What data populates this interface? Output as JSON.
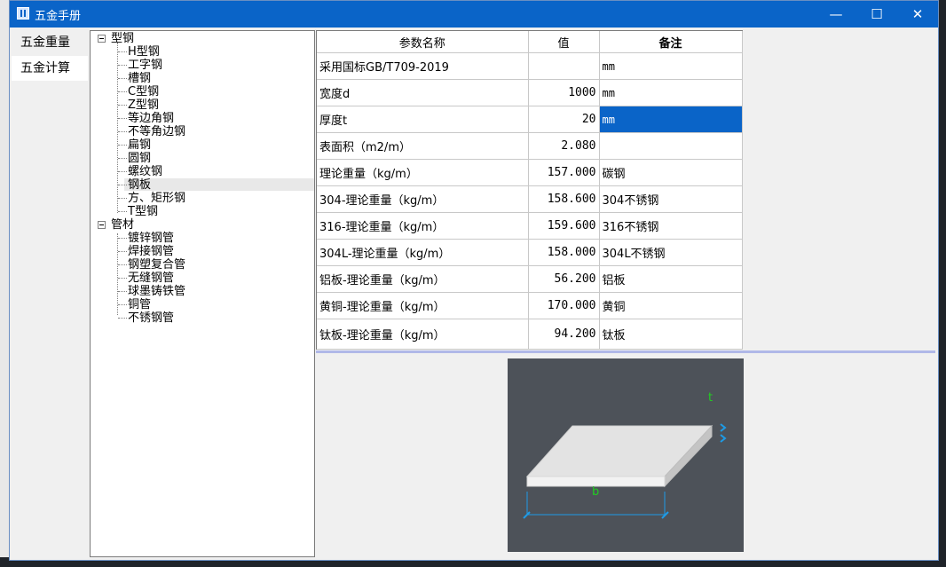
{
  "window": {
    "title": "五金手册",
    "controls": {
      "minimize": "—",
      "maximize": "☐",
      "close": "✕"
    }
  },
  "nav": {
    "items": [
      {
        "label": "五金重量",
        "active": false
      },
      {
        "label": "五金计算",
        "active": true
      }
    ]
  },
  "tree": {
    "groups": [
      {
        "label": "型钢",
        "children": [
          "H型钢",
          "工字钢",
          "槽钢",
          "C型钢",
          "Z型钢",
          "等边角钢",
          "不等角边钢",
          "扁钢",
          "圆钢",
          "螺纹钢",
          "钢板",
          "方、矩形钢",
          "T型钢"
        ]
      },
      {
        "label": "管材",
        "children": [
          "镀锌钢管",
          "焊接钢管",
          "钢塑复合管",
          "无缝钢管",
          "球墨铸铁管",
          "铜管",
          "不锈钢管"
        ]
      }
    ],
    "selected": "钢板"
  },
  "table": {
    "headers": [
      "参数名称",
      "值",
      "备注"
    ],
    "rows": [
      {
        "name": "采用国标GB/T709-2019",
        "value": "",
        "note": "mm"
      },
      {
        "name": "宽度d",
        "value": "1000",
        "note": "mm"
      },
      {
        "name": "厚度t",
        "value": "20",
        "note": "mm",
        "selected": true
      },
      {
        "name": "表面积（m2/m）",
        "value": "2.080",
        "note": ""
      },
      {
        "name": "理论重量（kg/m）",
        "value": "157.000",
        "note": "碳钢"
      },
      {
        "name": "304-理论重量（kg/m）",
        "value": "158.600",
        "note": "304不锈钢"
      },
      {
        "name": "316-理论重量（kg/m）",
        "value": "159.600",
        "note": "316不锈钢"
      },
      {
        "name": "304L-理论重量（kg/m）",
        "value": "158.000",
        "note": "304L不锈钢"
      },
      {
        "name": "铝板-理论重量（kg/m）",
        "value": "56.200",
        "note": "铝板"
      },
      {
        "name": "黄铜-理论重量（kg/m）",
        "value": "170.000",
        "note": "黄铜"
      },
      {
        "name": "钛板-理论重量（kg/m）",
        "value": "94.200",
        "note": "钛板"
      }
    ]
  },
  "diagram": {
    "labels": {
      "thickness": "t",
      "width": "b"
    },
    "colors": {
      "background": "#4d5259",
      "plate_top": "#e3e3e3",
      "plate_front": "#f2f2f2",
      "plate_side": "#c4c4c4",
      "label": "#22cc22",
      "dimension": "#1e9be6"
    }
  }
}
